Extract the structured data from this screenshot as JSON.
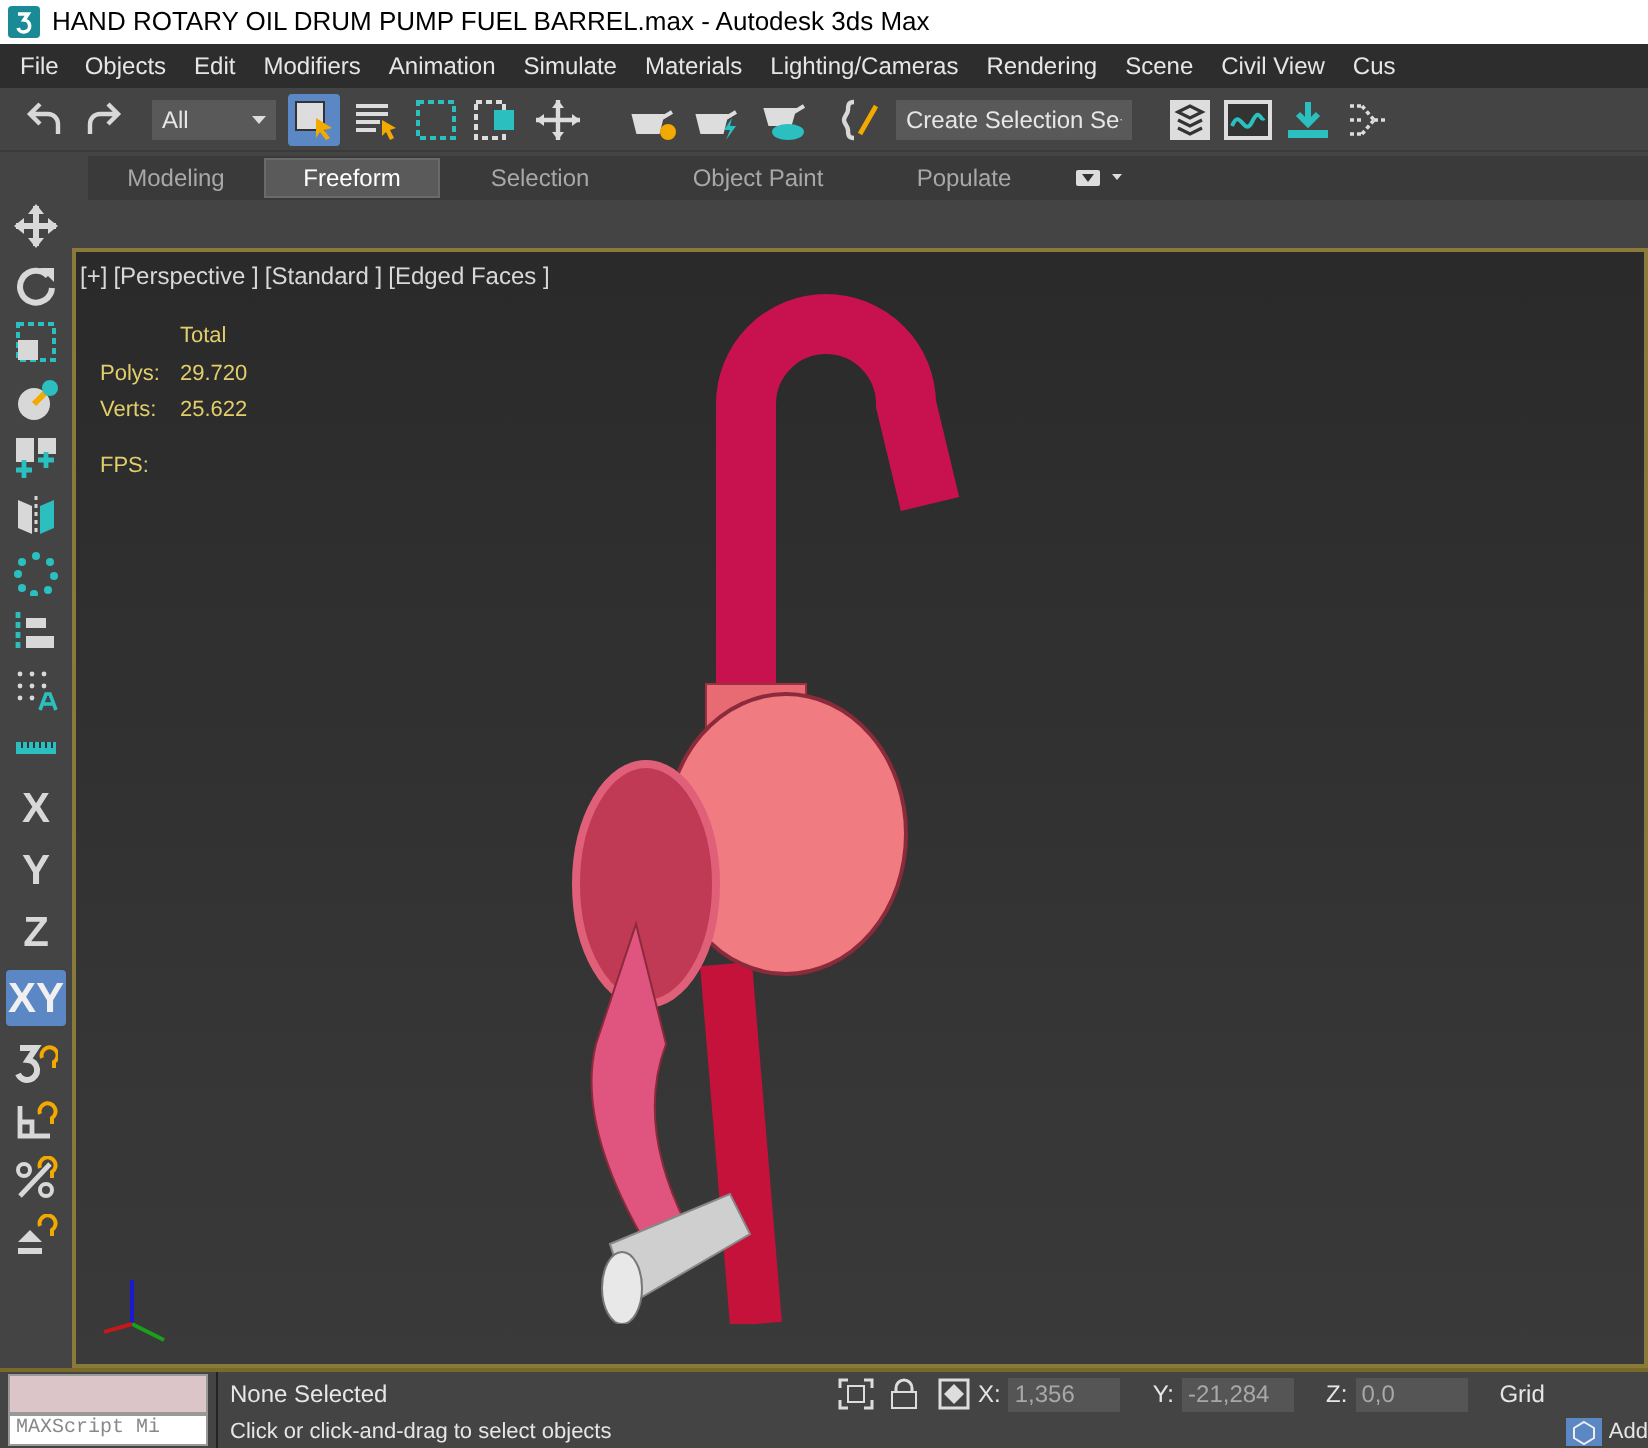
{
  "window": {
    "title": "HAND ROTARY OIL DRUM PUMP FUEL BARREL.max - Autodesk 3ds Max"
  },
  "menu": [
    "File",
    "Objects",
    "Edit",
    "Modifiers",
    "Animation",
    "Simulate",
    "Materials",
    "Lighting/Cameras",
    "Rendering",
    "Scene",
    "Civil View",
    "Cus"
  ],
  "toolbar": {
    "selection_filter": "All",
    "named_selection": "Create Selection Se"
  },
  "ribbon_tabs": [
    {
      "label": "Modeling",
      "selected": false
    },
    {
      "label": "Freeform",
      "selected": true
    },
    {
      "label": "Selection",
      "selected": false
    },
    {
      "label": "Object Paint",
      "selected": false
    },
    {
      "label": "Populate",
      "selected": false
    }
  ],
  "axis_constraints": [
    {
      "label": "X",
      "selected": false
    },
    {
      "label": "Y",
      "selected": false
    },
    {
      "label": "Z",
      "selected": false
    },
    {
      "label": "XY",
      "selected": true
    }
  ],
  "viewport": {
    "labels": [
      "[+]",
      "[Perspective ]",
      "[Standard ]",
      "[Edged Faces ]"
    ],
    "stats": {
      "header": "Total",
      "rows": [
        {
          "label": "Polys:",
          "value": "29.720"
        },
        {
          "label": "Verts:",
          "value": "25.622"
        }
      ],
      "fps": "FPS:"
    }
  },
  "status_bar": {
    "maxscript_placeholder": "MAXScript Mi",
    "selection": "None Selected",
    "prompt": "Click or click-and-drag to select objects",
    "coords": [
      {
        "label": "X:",
        "value": "1,356",
        "disabled": true
      },
      {
        "label": "Y:",
        "value": "-21,284",
        "disabled": true
      },
      {
        "label": "Z:",
        "value": "0,0",
        "disabled": true
      }
    ],
    "grid": "Grid",
    "add": "Add"
  }
}
